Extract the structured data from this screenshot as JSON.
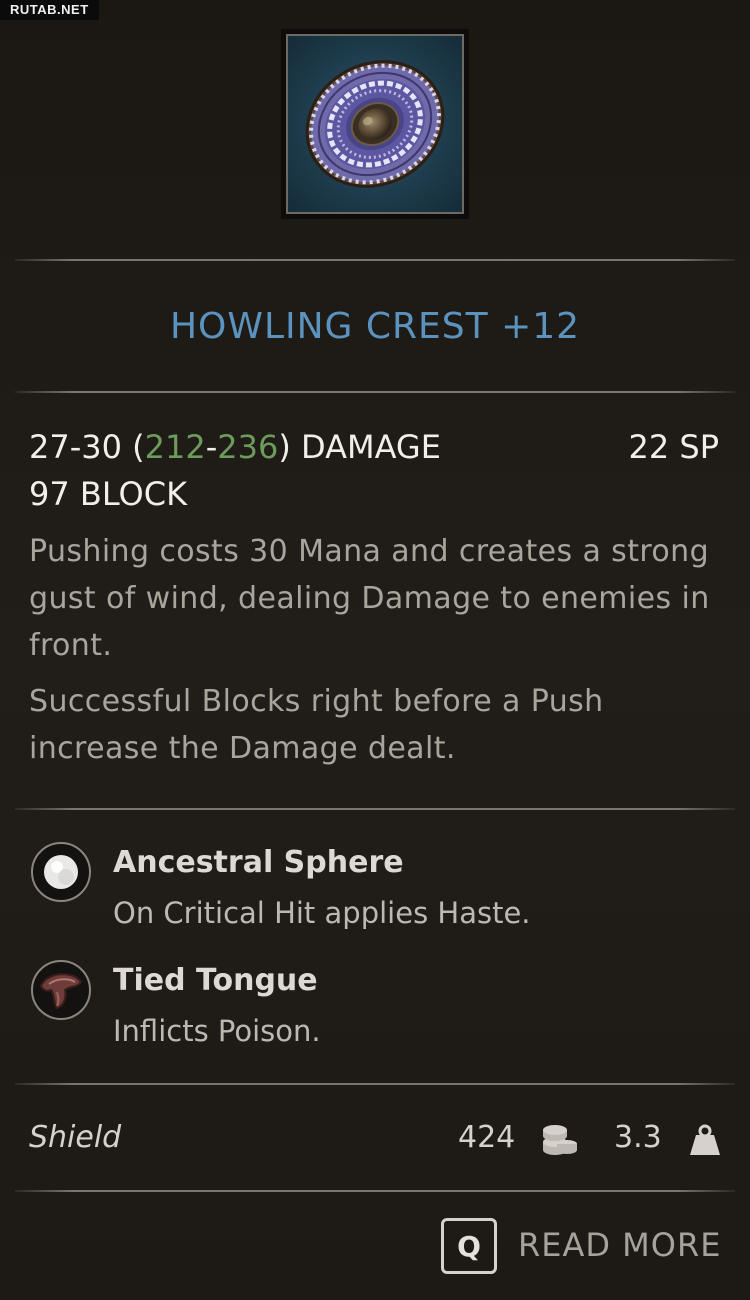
{
  "watermark": "RUTAB.NET",
  "item": {
    "icon": "round-shield-icon",
    "name": "HOWLING CREST +12",
    "damage": {
      "base": "27-30",
      "open": " (",
      "min_scaled": "212",
      "dash": "-",
      "max_scaled": "236",
      "close": ")",
      "label": " DAMAGE"
    },
    "stamina": "22 SP",
    "block": "97 BLOCK",
    "description": [
      "Pushing costs 30 Mana and creates a strong gust of wind, dealing Damage to enemies in front.",
      "Successful Blocks right before a Push increase the Damage dealt."
    ]
  },
  "gems": [
    {
      "icon": "white-pearl-icon",
      "name": "Ancestral Sphere",
      "effect": "On Critical Hit applies Haste."
    },
    {
      "icon": "tied-tongue-icon",
      "name": "Tied Tongue",
      "effect": "Inflicts Poison."
    }
  ],
  "footer": {
    "type": "Shield",
    "price": "424",
    "price_icon": "coins-icon",
    "weight": "3.3",
    "weight_icon": "weight-icon"
  },
  "actions": {
    "key": "Q",
    "read_more": "READ MORE"
  },
  "colors": {
    "title": "#5b93be",
    "scaled_damage": "#6d9b5b",
    "background": "#1c1915"
  }
}
